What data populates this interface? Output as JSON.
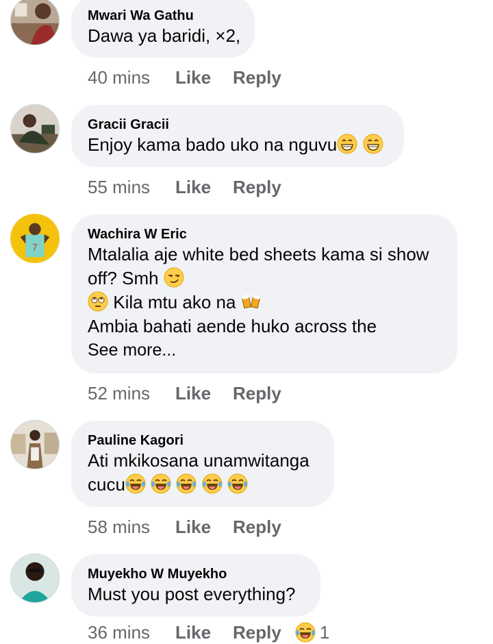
{
  "comments": [
    {
      "name": "Mwari Wa Gathu",
      "lines": [
        "Dawa ya baridi, ×2,"
      ],
      "time": "40 mins",
      "like": "Like",
      "reply": "Reply"
    },
    {
      "name": "Gracii Gracii",
      "lines": [
        "Enjoy kama bado uko na nguvu"
      ],
      "time": "55 mins",
      "like": "Like",
      "reply": "Reply"
    },
    {
      "name": "Wachira W Eric",
      "lines": [
        "Mtalalia aje white bed sheets kama si show",
        "off? Smh",
        "Kila mtu ako na",
        "Ambia bahati aende huko across the"
      ],
      "see_more": "See more...",
      "time": "52 mins",
      "like": "Like",
      "reply": "Reply"
    },
    {
      "name": "Pauline Kagori",
      "lines": [
        "Ati mkikosana unamwitanga",
        "cucu"
      ],
      "time": "58 mins",
      "like": "Like",
      "reply": "Reply"
    },
    {
      "name": "Muyekho W Muyekho",
      "lines": [
        "Must you post everything?"
      ],
      "time": "36 mins",
      "like": "Like",
      "reply": "Reply",
      "reaction_count": "1"
    }
  ],
  "emojis": {
    "grin": "grinning-face-icon",
    "smirk": "smirking-face-icon",
    "eyeroll": "face-with-rolling-eyes-icon",
    "beers": "clinking-beer-mugs-icon",
    "laugh": "tears-of-joy-icon"
  },
  "colors": {
    "bubble": "#f0f2f5",
    "meta": "#65676b",
    "text": "#050505",
    "emoji": "#ffcc4d"
  }
}
